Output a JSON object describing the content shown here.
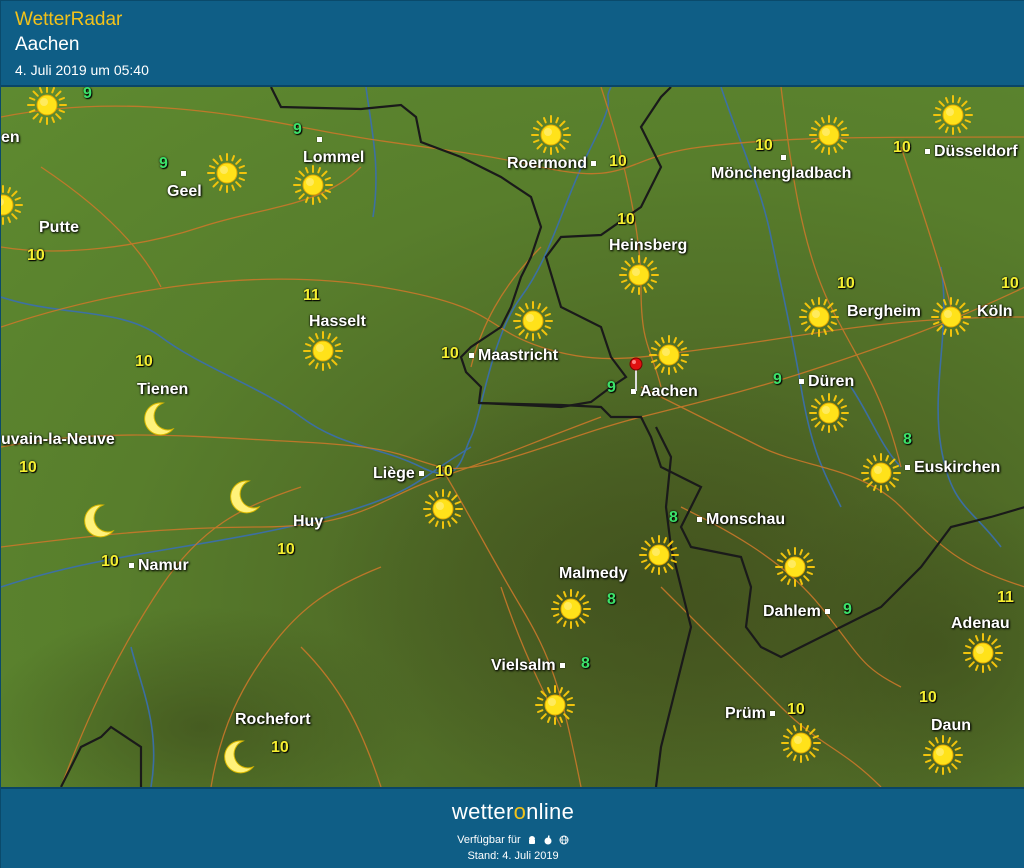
{
  "header": {
    "app_title": "WetterRadar",
    "location": "Aachen",
    "timestamp": "4. Juli 2019 um 05:40"
  },
  "colors": {
    "header_bg": "#0f5e86",
    "accent_yellow": "#f3c21a",
    "terrain_green": "#5e8a30",
    "border_black": "#1a1a1a",
    "river_blue": "#3a6fb0",
    "road_orange": "#c9782a",
    "pin_red": "#e01010"
  },
  "map": {
    "selected_city": "Aachen",
    "cities": [
      {
        "id": "roermond",
        "name": "Roermond",
        "temp": "10",
        "temp_color": "yellow"
      },
      {
        "id": "moenchengladbach",
        "name": "Mönchengladbach",
        "temp": "10",
        "temp_color": "yellow"
      },
      {
        "id": "duesseldorf",
        "name": "Düsseldorf",
        "temp": "10",
        "temp_color": "yellow"
      },
      {
        "id": "lommel",
        "name": "Lommel",
        "temp": "9",
        "temp_color": "green"
      },
      {
        "id": "geel",
        "name": "Geel",
        "temp": "9",
        "temp_color": "green"
      },
      {
        "id": "putte",
        "name": "Putte",
        "temp": "10",
        "temp_color": "yellow"
      },
      {
        "id": "heinsberg",
        "name": "Heinsberg",
        "temp": "10",
        "temp_color": "yellow"
      },
      {
        "id": "bergheim",
        "name": "Bergheim",
        "temp": "10",
        "temp_color": "yellow"
      },
      {
        "id": "koeln",
        "name": "Köln",
        "temp": "10",
        "temp_color": "yellow"
      },
      {
        "id": "hasselt",
        "name": "Hasselt",
        "temp": "11",
        "temp_color": "yellow"
      },
      {
        "id": "maastricht",
        "name": "Maastricht",
        "temp": "10",
        "temp_color": "yellow"
      },
      {
        "id": "tienen",
        "name": "Tienen",
        "temp": "10",
        "temp_color": "yellow"
      },
      {
        "id": "aachen",
        "name": "Aachen",
        "temp": "9",
        "temp_color": "green"
      },
      {
        "id": "dueren",
        "name": "Düren",
        "temp": "9",
        "temp_color": "green"
      },
      {
        "id": "louvain",
        "name": "uvain-la-Neuve",
        "temp": "10",
        "temp_color": "yellow"
      },
      {
        "id": "liege",
        "name": "Liège",
        "temp": "10",
        "temp_color": "yellow"
      },
      {
        "id": "euskirchen",
        "name": "Euskirchen",
        "temp": "8",
        "temp_color": "green"
      },
      {
        "id": "huy",
        "name": "Huy",
        "temp": "10",
        "temp_color": "yellow"
      },
      {
        "id": "monschau",
        "name": "Monschau",
        "temp": "8",
        "temp_color": "green"
      },
      {
        "id": "namur",
        "name": "Namur",
        "temp": "10",
        "temp_color": "yellow"
      },
      {
        "id": "malmedy",
        "name": "Malmedy",
        "temp": "8",
        "temp_color": "green"
      },
      {
        "id": "dahlem",
        "name": "Dahlem",
        "temp": "9",
        "temp_color": "green"
      },
      {
        "id": "adenau",
        "name": "Adenau",
        "temp": "11",
        "temp_color": "yellow"
      },
      {
        "id": "vielsalm",
        "name": "Vielsalm",
        "temp": "8",
        "temp_color": "green"
      },
      {
        "id": "pruem",
        "name": "Prüm",
        "temp": "10",
        "temp_color": "yellow"
      },
      {
        "id": "daun",
        "name": "Daun",
        "temp": "10",
        "temp_color": "yellow"
      },
      {
        "id": "rochefort",
        "name": "Rochefort",
        "temp": "10",
        "temp_color": "yellow"
      },
      {
        "id": "edge-left-top",
        "name": "en",
        "temp": "",
        "temp_color": "yellow"
      },
      {
        "id": "edge-top-9",
        "name": "",
        "temp": "9",
        "temp_color": "green"
      }
    ],
    "icons": {
      "sun": "sun-icon",
      "sun_partly": "sun-with-cloud-icon",
      "moon": "moon-icon",
      "pin": "location-pin-icon"
    }
  },
  "footer": {
    "brand_prefix": "wetter",
    "brand_o": "o",
    "brand_suffix": "nline",
    "available_label": "Verfügbar für",
    "platform_icons": [
      "android-icon",
      "apple-icon",
      "web-icon"
    ],
    "stand": "Stand: 4. Juli 2019"
  }
}
